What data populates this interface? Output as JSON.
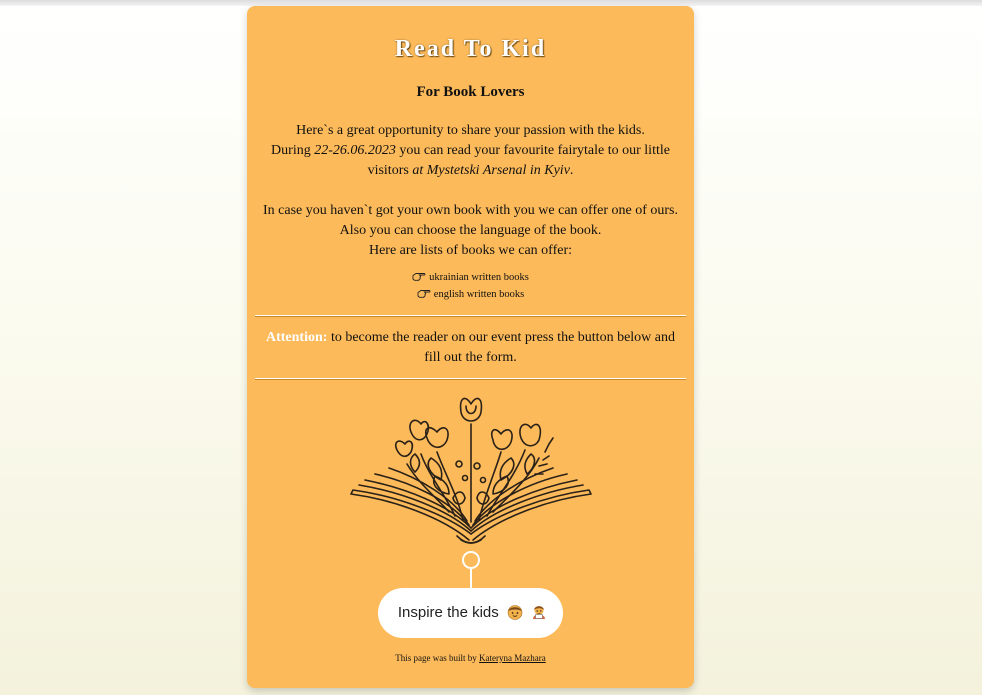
{
  "page": {
    "title": "Read To Kid",
    "subtitle": "For Book Lovers"
  },
  "intro": {
    "line1": "Here`s a great opportunity to share your passion with the kids.",
    "during_prefix": "During ",
    "dates": "22-26.06.2023",
    "during_mid": " you can read your favourite fairytale to our little visitors ",
    "location": "at Mystetski Arsenal in Kyiv",
    "during_end": "."
  },
  "books": {
    "line1": "In case you haven`t got your own book with you we can offer one of ours.",
    "line2": "Also you can choose the language of the book.",
    "line3": "Here are lists of books we can offer:",
    "links": [
      {
        "label": "ukrainian written books",
        "icon": "pointing-hand-icon"
      },
      {
        "label": "english written books",
        "icon": "pointing-hand-icon"
      }
    ]
  },
  "attention": {
    "label": "Attention:",
    "text": " to become the reader on our event press the button below and fill out the form."
  },
  "cta": {
    "label": "Inspire the kids",
    "icons": [
      "boy-face-icon",
      "reading-person-icon"
    ]
  },
  "footer": {
    "prefix": "This page was built by ",
    "author": "Kateryna Mazhara"
  },
  "colors": {
    "card": "#fdba5a",
    "title": "#ffffff",
    "attention_label": "#ffffff",
    "button": "#ffffff"
  }
}
